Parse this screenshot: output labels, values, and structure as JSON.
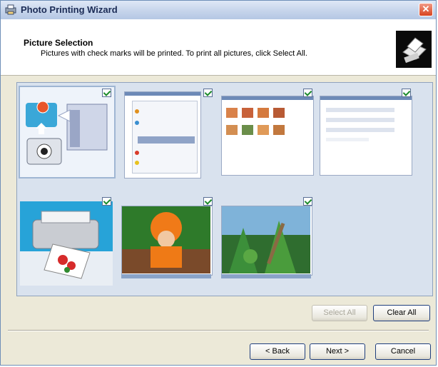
{
  "window": {
    "title": "Photo Printing Wizard",
    "close_label": "✕"
  },
  "header": {
    "title": "Picture Selection",
    "subtitle": "Pictures with check marks will be printed.  To print all pictures, click Select All."
  },
  "thumbnails": [
    {
      "name": "thumb-wizard-graphic",
      "checked": true
    },
    {
      "name": "thumb-dialog-screenshot",
      "checked": true
    },
    {
      "name": "thumb-photo-grid-screenshot",
      "checked": true
    },
    {
      "name": "thumb-settings-screenshot",
      "checked": true
    },
    {
      "name": "thumb-printer",
      "checked": true
    },
    {
      "name": "thumb-child-costume-photo",
      "checked": true
    },
    {
      "name": "thumb-garden-photo",
      "checked": true
    }
  ],
  "buttons": {
    "select_all": "Select All",
    "clear_all": "Clear All",
    "back": "< Back",
    "next": "Next >",
    "cancel": "Cancel"
  },
  "colors": {
    "accent": "#1f3e7c",
    "panel": "#d9e2ee",
    "checkmark": "#1b8a2a"
  }
}
